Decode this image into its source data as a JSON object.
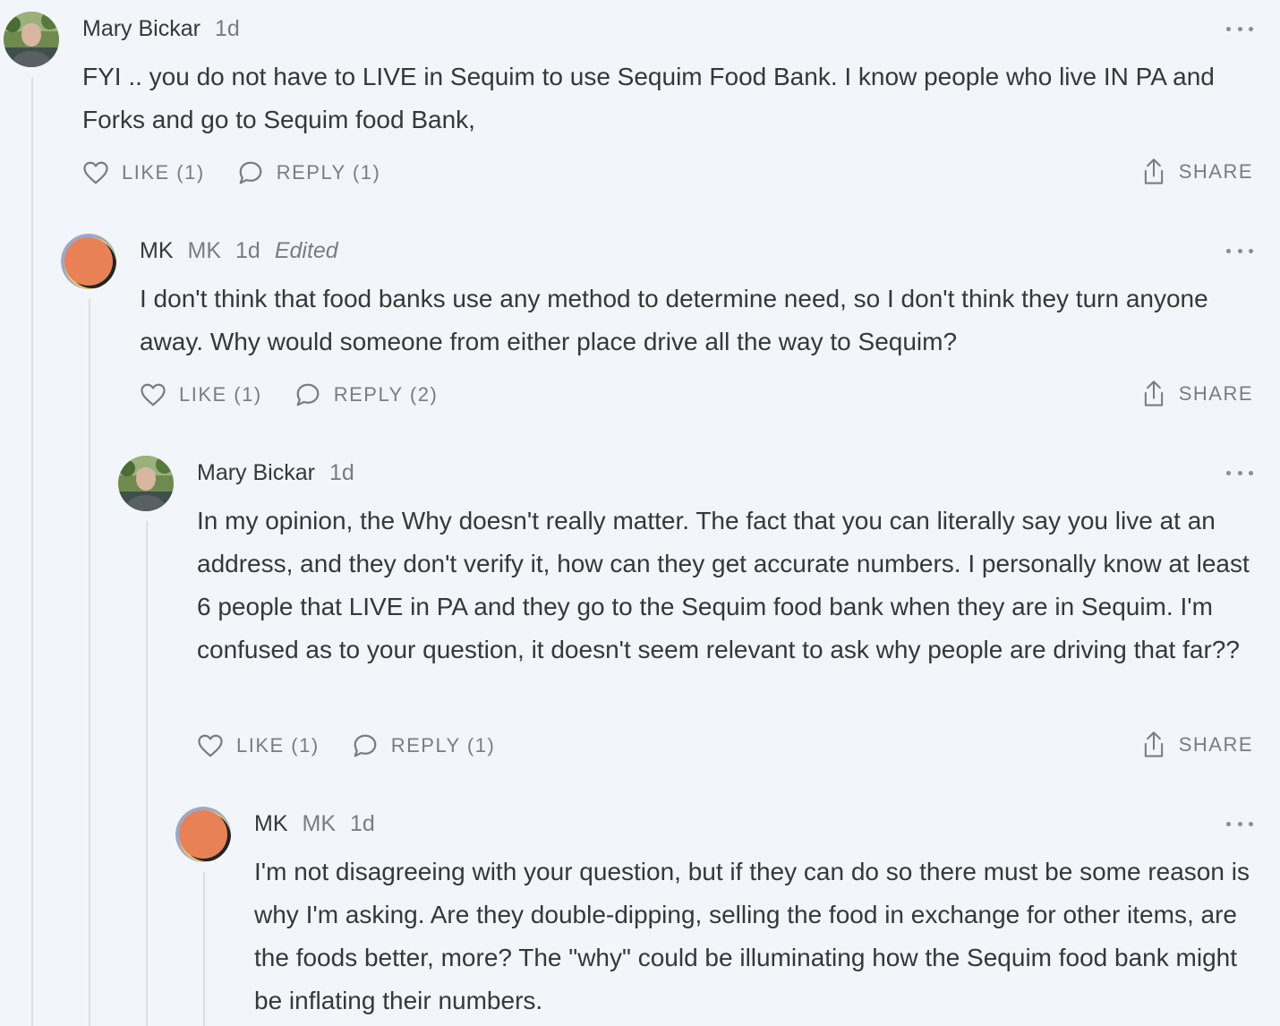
{
  "comments": [
    {
      "author": "Mary Bickar",
      "handle": "",
      "time": "1d",
      "edited": "",
      "avatar": "mary-avatar",
      "text": "FYI .. you do not have to LIVE in Sequim to use Sequim Food Bank. I know people who live IN PA and Forks and go to Sequim food Bank,",
      "like_label": "LIKE (1)",
      "reply_label": "REPLY (1)",
      "share_label": "SHARE"
    },
    {
      "author": "MK",
      "handle": "MK",
      "time": "1d",
      "edited": "Edited",
      "avatar": "mk-avatar",
      "text": "I don't think that food banks use any method to determine need, so I don't think they turn anyone away. Why would someone from either place drive all the way to Sequim?",
      "like_label": "LIKE (1)",
      "reply_label": "REPLY (2)",
      "share_label": "SHARE"
    },
    {
      "author": "Mary Bickar",
      "handle": "",
      "time": "1d",
      "edited": "",
      "avatar": "mary-avatar",
      "text": "In my opinion, the Why doesn't really matter. The fact that you can literally say you live at an address, and they don't verify it, how can they get accurate numbers. I personally know at least 6 people that LIVE in PA and they go to the Sequim food bank when they are in Sequim. I'm confused as to your question, it doesn't seem relevant to ask why people are driving that far??",
      "like_label": "LIKE (1)",
      "reply_label": "REPLY (1)",
      "share_label": "SHARE"
    },
    {
      "author": "MK",
      "handle": "MK",
      "time": "1d",
      "edited": "",
      "avatar": "mk-avatar",
      "text": "I'm not disagreeing with your question, but if they can do so there must be some reason is why I'm asking. Are they double-dipping, selling the food in exchange for other items, are the foods better, more? The \"why\" could be illuminating how the Sequim food bank might be inflating their numbers."
    }
  ],
  "colors": {
    "background": "#f2f6fa",
    "text": "#363737",
    "muted": "#7a7d80",
    "thread_line": "#dcdfe3",
    "mk_avatar": "#e98157"
  }
}
